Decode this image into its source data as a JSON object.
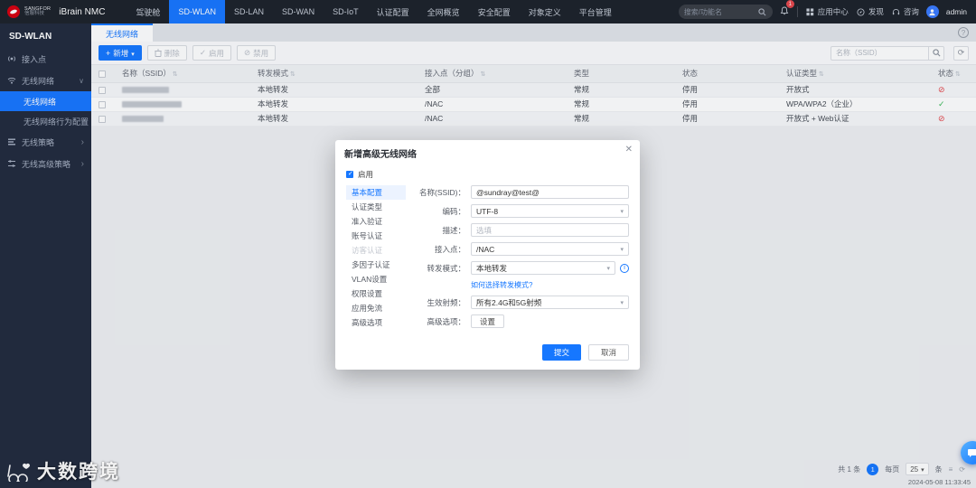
{
  "topbar": {
    "brand": {
      "company": "SANGFOR",
      "company_cn": "信服科技",
      "product": "iBrain NMC"
    },
    "nav": [
      {
        "label": "驾驶舱"
      },
      {
        "label": "SD-WLAN"
      },
      {
        "label": "SD-LAN"
      },
      {
        "label": "SD-WAN"
      },
      {
        "label": "SD-IoT"
      },
      {
        "label": "认证配置"
      },
      {
        "label": "全网概览"
      },
      {
        "label": "安全配置"
      },
      {
        "label": "对象定义"
      },
      {
        "label": "平台管理"
      }
    ],
    "search_placeholder": "搜索/功能名",
    "notification_count": "1",
    "links": [
      {
        "label": "应用中心"
      },
      {
        "label": "发现"
      },
      {
        "label": "咨询"
      }
    ],
    "user": "admin"
  },
  "sidebar": {
    "title": "SD-WLAN",
    "item_ap": "接入点",
    "group_wireless": "无线网络",
    "sub_active": "无线网络",
    "sub_config": "无线网络行为配置",
    "item_policy": "无线策略",
    "item_adv_policy": "无线高级策略"
  },
  "tab": {
    "label": "无线网络"
  },
  "toolbar": {
    "add": "新增",
    "delete": "删除",
    "enable": "启用",
    "disable": "禁用",
    "search_placeholder": "名称（SSID）"
  },
  "table": {
    "columns": [
      "名称（SSID）",
      "转发模式",
      "接入点（分组）",
      "类型",
      "状态",
      "认证类型",
      "状态"
    ],
    "rows": [
      {
        "forward": "本地转发",
        "ap": "全部",
        "type": "常规",
        "status": "停用",
        "auth": "开放式",
        "state": "disabled",
        "state_glyph": "⊘"
      },
      {
        "forward": "本地转发",
        "ap": "/NAC",
        "type": "常规",
        "status": "停用",
        "auth": "WPA/WPA2（企业）",
        "state": "enabled",
        "state_glyph": "✓"
      },
      {
        "forward": "本地转发",
        "ap": "/NAC",
        "type": "常规",
        "status": "停用",
        "auth": "开放式 + Web认证",
        "state": "disabled",
        "state_glyph": "⊘"
      }
    ]
  },
  "pagination": {
    "total": "共 1 条",
    "page": "1",
    "per_prefix": "每页",
    "per_page": "25",
    "per_suffix": "条"
  },
  "modal": {
    "title": "新增高级无线网络",
    "enable_label": "启用",
    "nav": [
      {
        "label": "基本配置"
      },
      {
        "label": "认证类型"
      },
      {
        "label": "准入验证"
      },
      {
        "label": "账号认证"
      },
      {
        "label": "访客认证"
      },
      {
        "label": "多因子认证"
      },
      {
        "label": "VLAN设置"
      },
      {
        "label": "权限设置"
      },
      {
        "label": "应用免流"
      },
      {
        "label": "高级选项"
      }
    ],
    "fields": {
      "name_label": "名称(SSID)：",
      "name_value": "@sundray@test@",
      "encoding_label": "编码：",
      "encoding_value": "UTF-8",
      "desc_label": "描述：",
      "desc_placeholder": "选填",
      "ap_label": "接入点：",
      "ap_value": "/NAC",
      "forward_label": "转发模式：",
      "forward_value": "本地转发",
      "help_link": "如何选择转发模式?",
      "radio_label": "生效射频：",
      "radio_value": "所有2.4G和5G射频",
      "adv_label": "高级选项：",
      "adv_button": "设置"
    },
    "submit": "提交",
    "cancel": "取消"
  },
  "footer": {
    "timestamp": "2024-05-08 11:33:45"
  },
  "watermark": {
    "text": "大数跨境"
  }
}
